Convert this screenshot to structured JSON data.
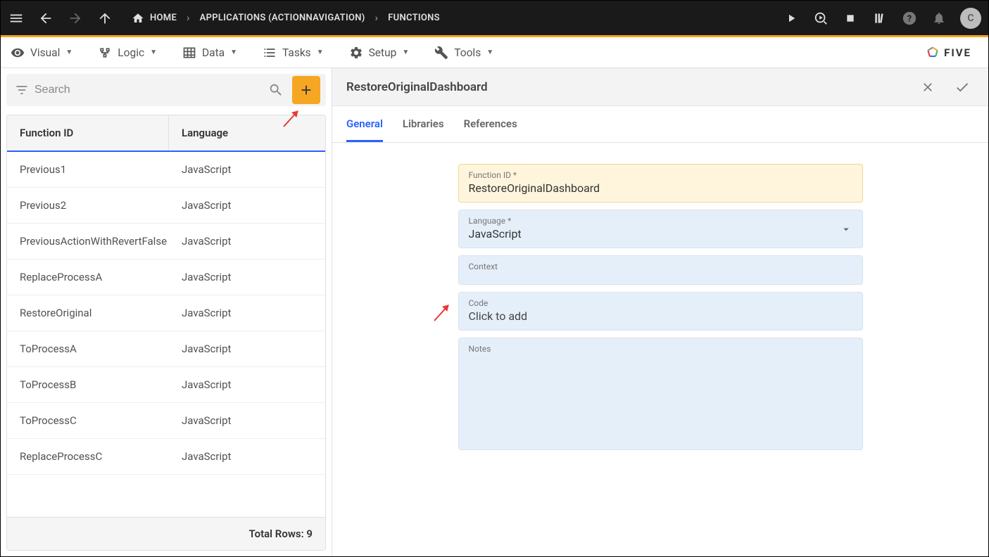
{
  "topbar": {
    "breadcrumb": [
      {
        "label": "HOME"
      },
      {
        "label": "APPLICATIONS (ACTIONNAVIGATION)"
      },
      {
        "label": "FUNCTIONS"
      }
    ],
    "avatar_letter": "C"
  },
  "menubar": {
    "items": [
      {
        "label": "Visual"
      },
      {
        "label": "Logic"
      },
      {
        "label": "Data"
      },
      {
        "label": "Tasks"
      },
      {
        "label": "Setup"
      },
      {
        "label": "Tools"
      }
    ],
    "brand": "FIVE"
  },
  "search": {
    "placeholder": "Search"
  },
  "table": {
    "columns": [
      "Function ID",
      "Language"
    ],
    "rows": [
      {
        "id": "Previous1",
        "lang": "JavaScript"
      },
      {
        "id": "Previous2",
        "lang": "JavaScript"
      },
      {
        "id": "PreviousActionWithRevertFalse",
        "lang": "JavaScript"
      },
      {
        "id": "ReplaceProcessA",
        "lang": "JavaScript"
      },
      {
        "id": "RestoreOriginal",
        "lang": "JavaScript"
      },
      {
        "id": "ToProcessA",
        "lang": "JavaScript"
      },
      {
        "id": "ToProcessB",
        "lang": "JavaScript"
      },
      {
        "id": "ToProcessC",
        "lang": "JavaScript"
      },
      {
        "id": "ReplaceProcessC",
        "lang": "JavaScript"
      }
    ],
    "footer": "Total Rows: 9"
  },
  "detail": {
    "title": "RestoreOriginalDashboard",
    "tabs": [
      "General",
      "Libraries",
      "References"
    ],
    "active_tab": 0,
    "fields": {
      "function_id_label": "Function ID *",
      "function_id_value": "RestoreOriginalDashboard",
      "language_label": "Language *",
      "language_value": "JavaScript",
      "context_label": "Context",
      "context_value": "",
      "code_label": "Code",
      "code_value": "Click to add",
      "notes_label": "Notes",
      "notes_value": ""
    }
  }
}
